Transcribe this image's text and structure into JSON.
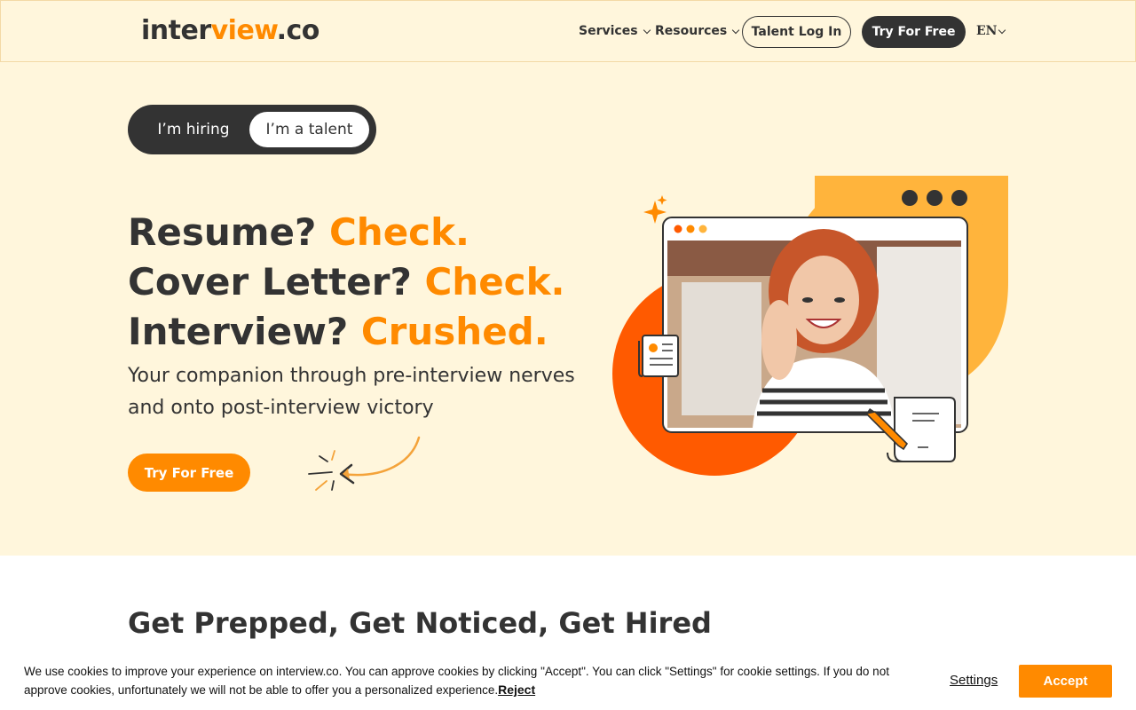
{
  "header": {
    "logo": {
      "part1": "inter",
      "part2": "view",
      "part3": ".co"
    },
    "nav": [
      {
        "label": "Services"
      },
      {
        "label": "Resources"
      }
    ],
    "talent_login": "Talent Log In",
    "try_free": "Try For Free",
    "lang": "EN"
  },
  "hero": {
    "toggle": {
      "hiring": "I’m hiring",
      "talent": "I’m a talent"
    },
    "headline": [
      {
        "plain": "Resume? ",
        "accent": "Check."
      },
      {
        "plain": "Cover Letter? ",
        "accent": "Check."
      },
      {
        "plain": "Interview? ",
        "accent": "Crushed."
      }
    ],
    "subtitle": "Your companion through pre-interview nerves and onto post-interview victory",
    "cta": "Try For Free"
  },
  "section": {
    "title": "Get Prepped, Get Noticed, Get Hired"
  },
  "cookie": {
    "text": "We use cookies to improve your experience on interview.co. You can approve cookies by clicking \"Accept\". You can click \"Settings\" for cookie settings. If you do not approve cookies, unfortunately we will not be able to offer you a personalized experience.",
    "reject": "Reject",
    "settings": "Settings",
    "accept": "Accept"
  },
  "colors": {
    "accent": "#ff8a00",
    "dark": "#333333",
    "cream": "#fff6dc",
    "orange_red": "#ff5a00",
    "yellow": "#ffb43c"
  }
}
